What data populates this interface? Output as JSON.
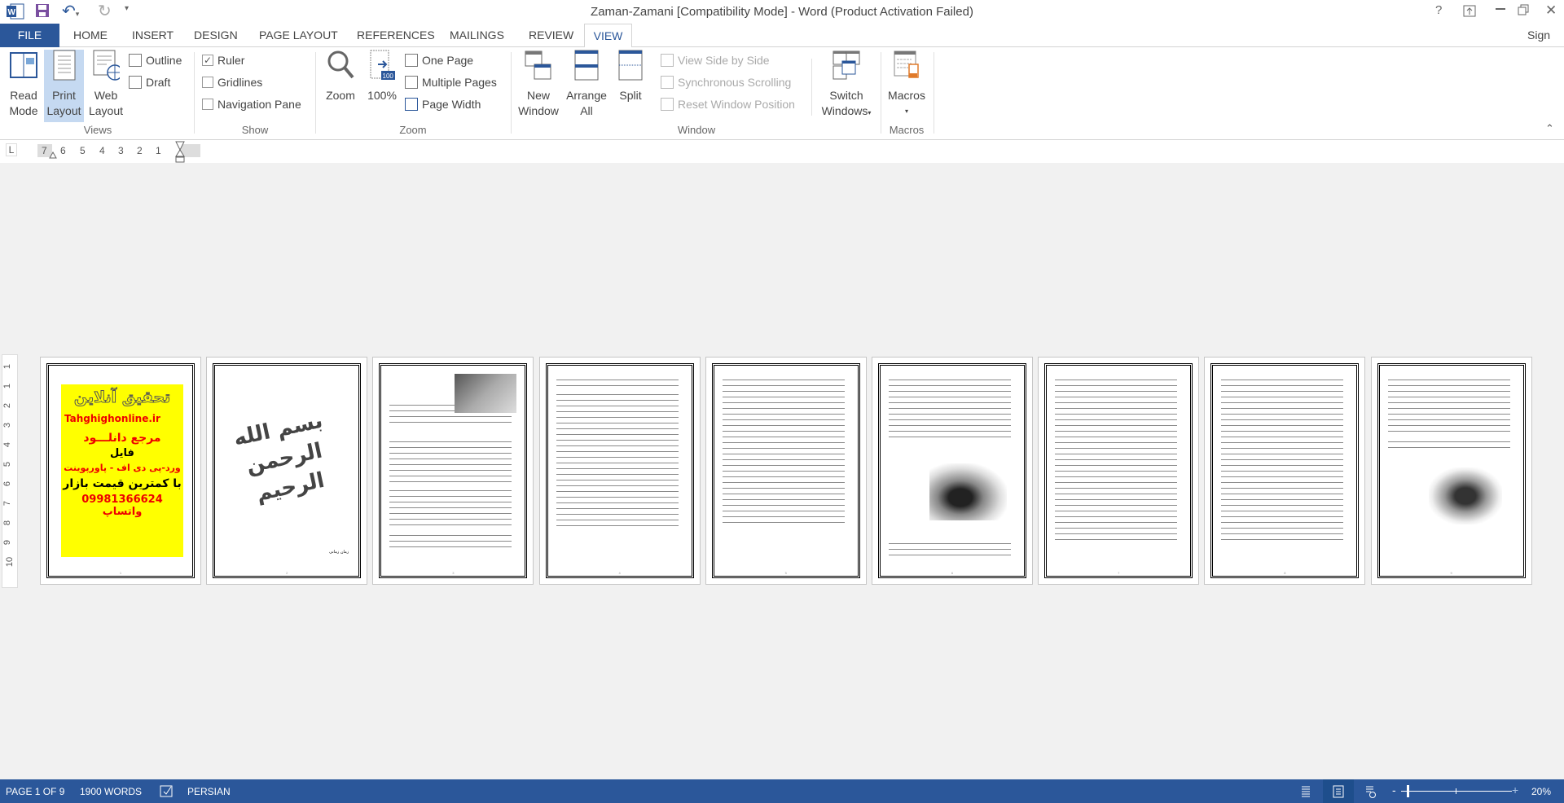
{
  "window": {
    "title": "Zaman-Zamani [Compatibility Mode] - Word (Product Activation Failed)",
    "controls": [
      "?",
      "restore-ribbon",
      "minimize",
      "maximize",
      "close"
    ]
  },
  "quick_access": [
    "word-logo",
    "save",
    "undo",
    "redo",
    "customize"
  ],
  "tabs": {
    "file": "FILE",
    "items": [
      "HOME",
      "INSERT",
      "DESIGN",
      "PAGE LAYOUT",
      "REFERENCES",
      "MAILINGS",
      "REVIEW",
      "VIEW"
    ],
    "active": "VIEW",
    "sign_in": "Sign in"
  },
  "ribbon": {
    "views": {
      "label": "Views",
      "read_mode": [
        "Read",
        "Mode"
      ],
      "print_layout": [
        "Print",
        "Layout"
      ],
      "web_layout": [
        "Web",
        "Layout"
      ],
      "outline": "Outline",
      "draft": "Draft"
    },
    "show": {
      "label": "Show",
      "ruler": "Ruler",
      "ruler_checked": true,
      "gridlines": "Gridlines",
      "gridlines_checked": false,
      "nav_pane": "Navigation Pane",
      "nav_pane_checked": false
    },
    "zoom": {
      "label": "Zoom",
      "zoom": "Zoom",
      "hundred": "100%",
      "one_page": "One Page",
      "multiple_pages": "Multiple Pages",
      "page_width": "Page Width"
    },
    "window": {
      "label": "Window",
      "new_window": [
        "New",
        "Window"
      ],
      "arrange_all": [
        "Arrange",
        "All"
      ],
      "split": "Split",
      "side_by_side": "View Side by Side",
      "sync_scroll": "Synchronous Scrolling",
      "reset_pos": "Reset Window Position",
      "switch_windows": [
        "Switch",
        "Windows"
      ]
    },
    "macros": {
      "label": "Macros",
      "macros": "Macros"
    }
  },
  "ruler": {
    "h_ticks": [
      "7",
      "6",
      "5",
      "4",
      "3",
      "2",
      "1"
    ],
    "v_ticks": [
      "1",
      "1",
      "2",
      "3",
      "4",
      "5",
      "6",
      "7",
      "8",
      "9",
      "10"
    ]
  },
  "pages": {
    "p1": {
      "title": "تحقیق آنلاین",
      "site": "Tahghighonline.ir",
      "l1": "مرجع دانلـــود",
      "l2": "فایل",
      "l3": "ورد-پی دی اف - پاورپوینت",
      "l4": "با کمترین قیمت بازار",
      "l5": "09981366624 واتساپ",
      "bg": "#ffff00"
    },
    "p2": {
      "calligraphy": "بسم الله الرحمن الرحیم",
      "caption": "زمان زمانی"
    },
    "numbers": [
      "1",
      "2",
      "3",
      "4",
      "5",
      "6",
      "7",
      "8",
      "9"
    ]
  },
  "status": {
    "page": "PAGE 1 OF 9",
    "words": "1900 WORDS",
    "language": "PERSIAN",
    "zoom": "20%",
    "zoom_percent": 20,
    "accent": "#2b579a"
  }
}
